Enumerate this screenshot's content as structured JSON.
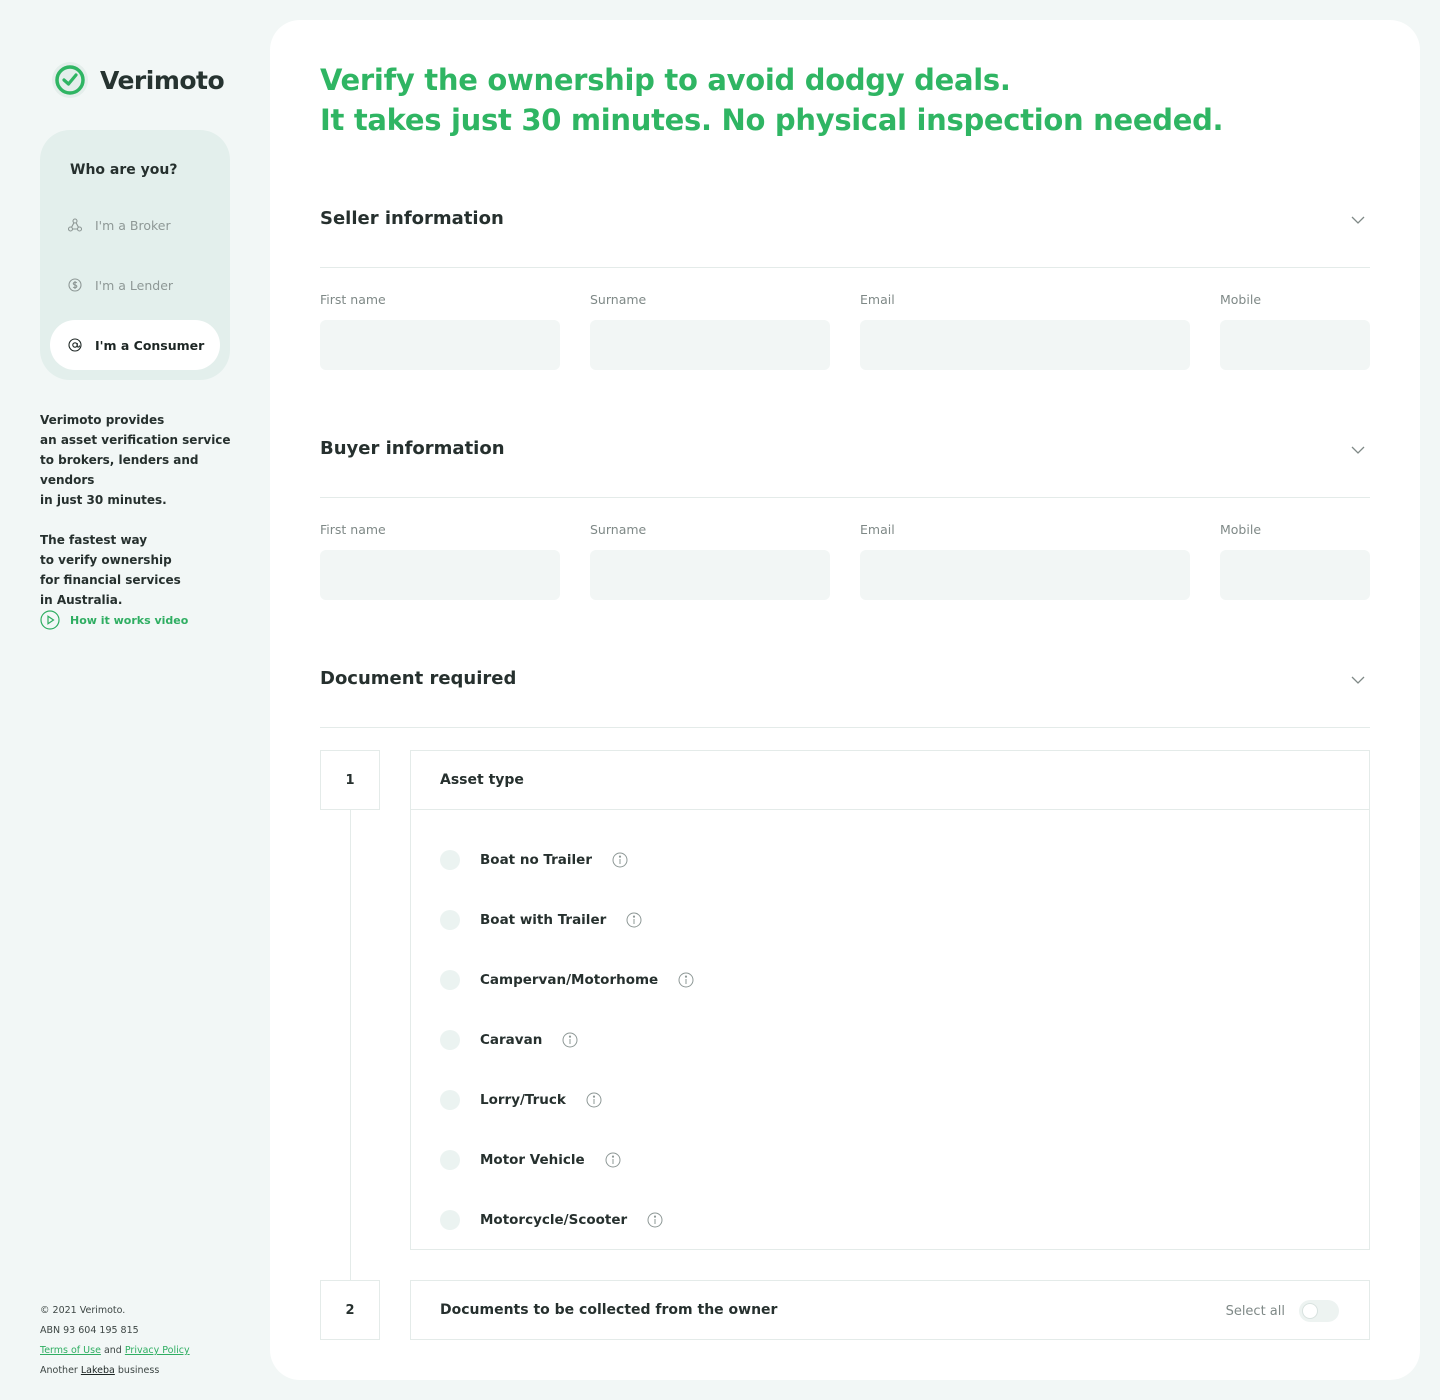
{
  "brand": {
    "name": "Verimoto",
    "accent": "#2fb563"
  },
  "sidebar": {
    "who_title": "Who are you?",
    "roles": [
      {
        "label": "I'm a Broker",
        "icon": "network-icon",
        "active": false
      },
      {
        "label": "I'm a Lender",
        "icon": "dollar-icon",
        "active": false
      },
      {
        "label": "I'm a Consumer",
        "icon": "at-icon",
        "active": true
      }
    ],
    "about_1": "Verimoto provides\nan asset verification service\nto brokers, lenders and vendors\nin just 30 minutes.",
    "about_2": "The fastest way\nto verify ownership\nfor financial services\nin Australia.",
    "video_link": "How it works video"
  },
  "footer": {
    "copyright": "© 2021 Verimoto.",
    "abn": "ABN 93 604 195 815",
    "terms": "Terms of Use",
    "and": "and",
    "privacy": "Privacy Policy",
    "another": "Another",
    "lakeba": "Lakeba",
    "business": "business"
  },
  "main": {
    "headline_1": "Verify the ownership to avoid dodgy deals.",
    "headline_2": "It takes just 30 minutes. No physical inspection needed.",
    "seller": {
      "title": "Seller information",
      "first_name": "First name",
      "surname": "Surname",
      "email": "Email",
      "mobile": "Mobile"
    },
    "buyer": {
      "title": "Buyer information",
      "first_name": "First name",
      "surname": "Surname",
      "email": "Email",
      "mobile": "Mobile"
    },
    "documents": {
      "title": "Document required",
      "step1": "1",
      "asset_type": "Asset type",
      "assets": [
        "Boat no Trailer",
        "Boat with Trailer",
        "Campervan/Motorhome",
        "Caravan",
        "Lorry/Truck",
        "Motor Vehicle",
        "Motorcycle/Scooter"
      ],
      "step2": "2",
      "collect_title": "Documents to be collected from the owner",
      "select_all": "Select all"
    }
  }
}
